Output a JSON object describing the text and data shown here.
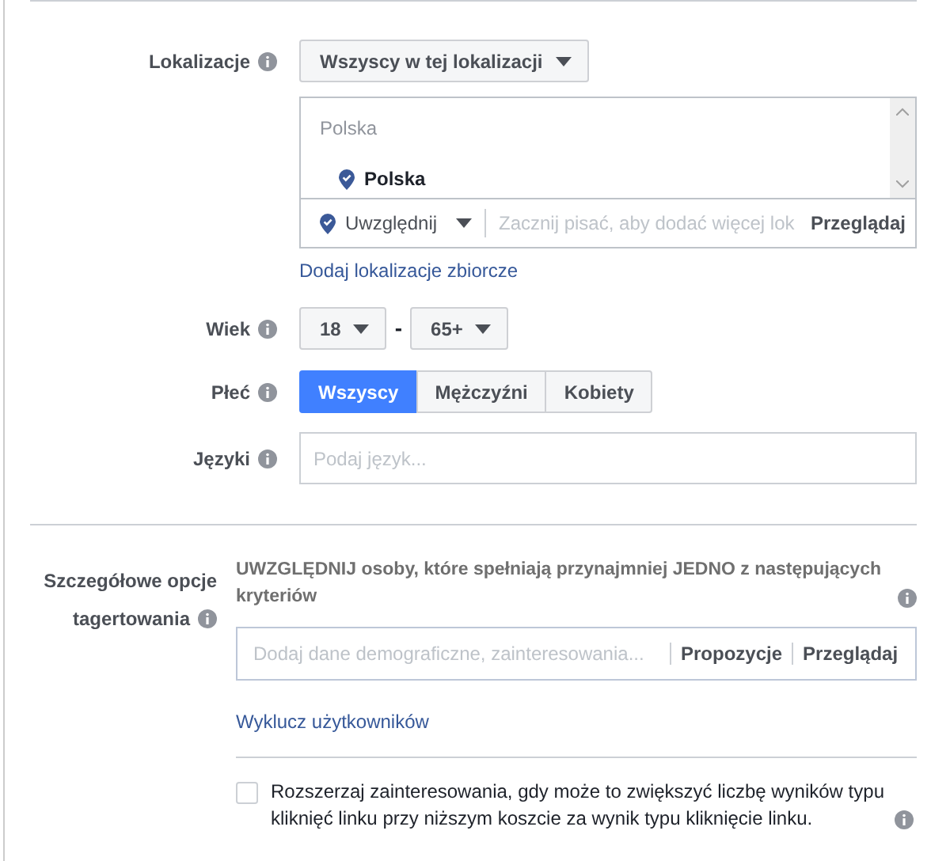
{
  "location": {
    "label": "Lokalizacje",
    "audience_dropdown": "Wszyscy w tej lokalizacji",
    "list_header": "Polska",
    "selected_locations": [
      {
        "name": "Polska"
      }
    ],
    "mode_dropdown": "Uwzględnij",
    "placeholder": "Zacznij pisać, aby dodać więcej lok",
    "browse": "Przeglądaj",
    "bulk_link": "Dodaj lokalizacje zbiorcze"
  },
  "age": {
    "label": "Wiek",
    "min": "18",
    "separator": "-",
    "max": "65+"
  },
  "gender": {
    "label": "Płeć",
    "options": [
      {
        "label": "Wszyscy",
        "selected": true
      },
      {
        "label": "Mężczyźni",
        "selected": false
      },
      {
        "label": "Kobiety",
        "selected": false
      }
    ]
  },
  "languages": {
    "label": "Języki",
    "placeholder": "Podaj język..."
  },
  "detailed_targeting": {
    "label_line_1": "Szczegółowe opcje",
    "label_line_2": "tagertowania",
    "description": "UWZGLĘDNIJ osoby, które spełniają przynajmniej JEDNO z następujących kryteriów",
    "placeholder": "Dodaj dane demograficzne, zainteresowania...",
    "suggestions": "Propozycje",
    "browse": "Przeglądaj",
    "exclude_link": "Wyklucz użytkowników"
  },
  "expand_interests": {
    "checked": false,
    "text": "Rozszerzaj zainteresowania, gdy może to zwiększyć liczbę wyników typu kliknięć linku przy niższym koszcie za wynik typu kliknięcie linku."
  }
}
